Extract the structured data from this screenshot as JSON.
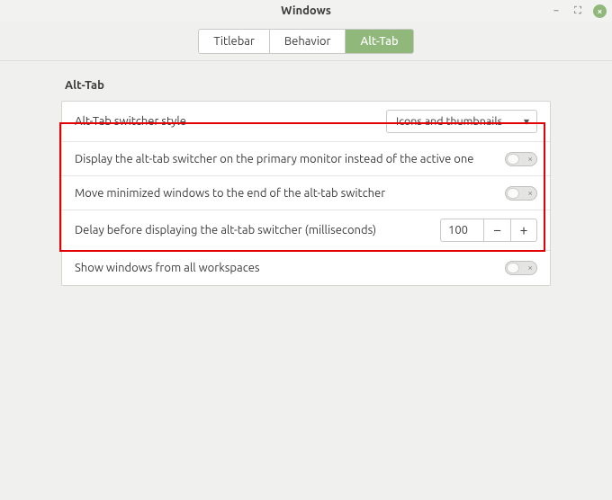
{
  "window": {
    "title": "Windows"
  },
  "tabs": {
    "titlebar": "Titlebar",
    "behavior": "Behavior",
    "alttab": "Alt-Tab"
  },
  "section": {
    "heading": "Alt-Tab"
  },
  "settings": {
    "style": {
      "label": "Alt-Tab switcher style",
      "value": "Icons and thumbnails"
    },
    "primary_monitor": {
      "label": "Display the alt-tab switcher on the primary monitor instead of the active one",
      "enabled": false
    },
    "move_minimized": {
      "label": "Move minimized windows to the end of the alt-tab switcher",
      "enabled": false
    },
    "delay": {
      "label": "Delay before displaying the alt-tab switcher (milliseconds)",
      "value": "100",
      "minus": "−",
      "plus": "+"
    },
    "all_workspaces": {
      "label": "Show windows from all workspaces",
      "enabled": false
    }
  },
  "icons": {
    "minimize": "−",
    "maximize": "⛶",
    "close": "×",
    "dropdown": "▾",
    "toggle_off": "×"
  }
}
